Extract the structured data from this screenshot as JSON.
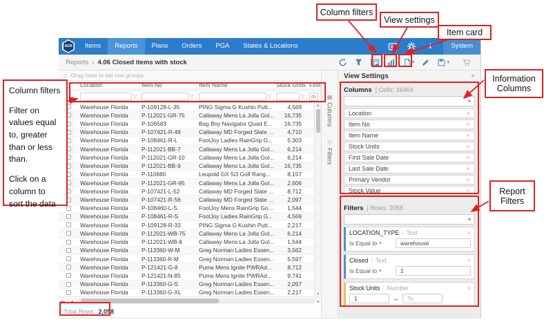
{
  "colors": {
    "navbar_blue": "#2d7cc9",
    "active_tab_blue": "#4a94da",
    "icon_blue": "#4a82b8",
    "annotation_red": "#e02020",
    "filter_accent_blue": "#4a90d9",
    "filter_accent_yellow": "#f2c14e"
  },
  "icons": {
    "breadcrumb_separator": "›",
    "caret_down": "▾",
    "close": "×",
    "column_funnel": "▽",
    "range_arrow": "↔",
    "up_arrow": "▴",
    "down_arrow": "▾",
    "left_arrow": "◂",
    "right_arrow": "▸",
    "pager": "◂▸",
    "group_icon": "≣"
  },
  "navbar": {
    "logo": "AGR",
    "tabs": [
      {
        "label": "Items",
        "active": false
      },
      {
        "label": "Reports",
        "active": true
      },
      {
        "label": "Plans",
        "active": false
      },
      {
        "label": "Orders",
        "active": false
      },
      {
        "label": "PGA",
        "active": false
      },
      {
        "label": "States & Locations",
        "active": false
      }
    ],
    "system_label": "System"
  },
  "toolbar": {
    "breadcrumb_section": "Reports",
    "breadcrumb_page": "4.06 Closed items with stock"
  },
  "grid": {
    "group_hint": "Drag here to set row groups",
    "columns": [
      "Location",
      "Item No",
      "Item Name",
      "Stock Units",
      "First"
    ],
    "date_filter_placeholder": "mm,",
    "rows": [
      {
        "location": "Warehouse Florida",
        "item_no": "P-109128-L-35",
        "item_name": "PING Sigma G Kushin Putt...",
        "stock_units": "4,569"
      },
      {
        "location": "Warehouse Florida",
        "item_no": "P-112021-GR-75",
        "item_name": "Callaway Mens La Jolla Gol...",
        "stock_units": "16,735"
      },
      {
        "location": "Warehouse Florida",
        "item_no": "P-106583",
        "item_name": "Bag Boy Navigator Quad E...",
        "stock_units": "16,735"
      },
      {
        "location": "Warehouse Florida",
        "item_no": "P-107421-R-48",
        "item_name": "Callaway MD Forged Slate ...",
        "stock_units": "4,710"
      },
      {
        "location": "Warehouse Florida",
        "item_no": "P-108461-R-L",
        "item_name": "FootJoy Ladies RainGrip G...",
        "stock_units": "5,303"
      },
      {
        "location": "Warehouse Florida",
        "item_no": "P-112021-BB-7",
        "item_name": "Callaway Mens La Jolla Gol...",
        "stock_units": "6,214"
      },
      {
        "location": "Warehouse Florida",
        "item_no": "P-112021-GR-10",
        "item_name": "Callaway Mens La Jolla Gol...",
        "stock_units": "6,214"
      },
      {
        "location": "Warehouse Florida",
        "item_no": "P-112021-BB-9",
        "item_name": "Callaway Mens La Jolla Gol...",
        "stock_units": "16,735"
      },
      {
        "location": "Warehouse Florida",
        "item_no": "P-110680",
        "item_name": "Leupold GX 5i3 Golf Rang...",
        "stock_units": "8,157"
      },
      {
        "location": "Warehouse Florida",
        "item_no": "P-112021-GR-95",
        "item_name": "Callaway Mens La Jolla Gol...",
        "stock_units": "2,606"
      },
      {
        "location": "Warehouse Florida",
        "item_no": "P-107421-L-52",
        "item_name": "Callaway MD Forged Slate ...",
        "stock_units": "8,712"
      },
      {
        "location": "Warehouse Florida",
        "item_no": "P-107421-R-56",
        "item_name": "Callaway MD Forged Slate ...",
        "stock_units": "2,097"
      },
      {
        "location": "Warehouse Florida",
        "item_no": "P-108460-L-S",
        "item_name": "FootJoy Mens RainGrip Go...",
        "stock_units": "1,544"
      },
      {
        "location": "Warehouse Florida",
        "item_no": "P-108461-R-S",
        "item_name": "FootJoy Ladies RainGrip G...",
        "stock_units": "4,569"
      },
      {
        "location": "Warehouse Florida",
        "item_no": "P-109128-R-33",
        "item_name": "PING Sigma G Kushin Putt...",
        "stock_units": "2,217"
      },
      {
        "location": "Warehouse Florida",
        "item_no": "P-112021-WB-75",
        "item_name": "Callaway Mens La Jolla Gol...",
        "stock_units": "6,214"
      },
      {
        "location": "Warehouse Florida",
        "item_no": "P-112021-WB-8",
        "item_name": "Callaway Mens La Jolla Gol...",
        "stock_units": "1,544"
      },
      {
        "location": "Warehouse Florida",
        "item_no": "P-113360-W-M",
        "item_name": "Greg Norman Ladies Essen...",
        "stock_units": "3,562"
      },
      {
        "location": "Warehouse Florida",
        "item_no": "P-113360-R-M",
        "item_name": "Greg Norman Ladies Essen...",
        "stock_units": "5,597"
      },
      {
        "location": "Warehouse Florida",
        "item_no": "P-121421-G-8",
        "item_name": "Puma Mens Ignite PWRAd...",
        "stock_units": "8,712"
      },
      {
        "location": "Warehouse Florida",
        "item_no": "P-121421-N-85",
        "item_name": "Puma Mens Ignite PWRAd...",
        "stock_units": "9,741"
      },
      {
        "location": "Warehouse Florida",
        "item_no": "P-113360-G-S",
        "item_name": "Greg Norman Ladies Essen...",
        "stock_units": "2,097"
      },
      {
        "location": "Warehouse Florida",
        "item_no": "P-113360-G-XL",
        "item_name": "Greg Norman Ladies Essen...",
        "stock_units": "2,217"
      }
    ],
    "footer_label": "Total Rows:",
    "footer_value": "2,058"
  },
  "side_tabs": {
    "columns": "Columns",
    "filters": "Filters"
  },
  "view_settings": {
    "title": "View Settings",
    "columns_section": {
      "title": "Columns",
      "meta": "Cells: 16464",
      "items": [
        "Location",
        "Item No",
        "Item Name",
        "Stock Units",
        "First Sale Date",
        "Last Sale Date",
        "Primary Vendor",
        "Stock Value"
      ]
    },
    "filters_section": {
      "title": "Filters",
      "meta": "Rows: 2058",
      "filters": [
        {
          "kind": "text",
          "name": "LOCATION_TYPE",
          "type_label": "Text",
          "operator": "Is Equal to",
          "value": "warehouse",
          "accent": "#4a90d9"
        },
        {
          "kind": "text",
          "name": "Closed",
          "type_label": "Text",
          "operator": "Is Equal to",
          "value": "1",
          "accent": "#4a90d9"
        },
        {
          "kind": "range",
          "name": "Stock Units",
          "type_label": "Number",
          "from": "1",
          "to_placeholder": "To",
          "accent": "#f2c14e"
        }
      ]
    }
  },
  "annotations": {
    "column_filters": "Column filters",
    "view_settings": "View settings",
    "item_card": "Item card",
    "information_columns": "Information Columns",
    "report_filters": "Report Filters",
    "note_title": "Column filters",
    "note_para1": "Filter on values equal to, greater than or less than.",
    "note_para2": "Click on a column to sort the data"
  }
}
